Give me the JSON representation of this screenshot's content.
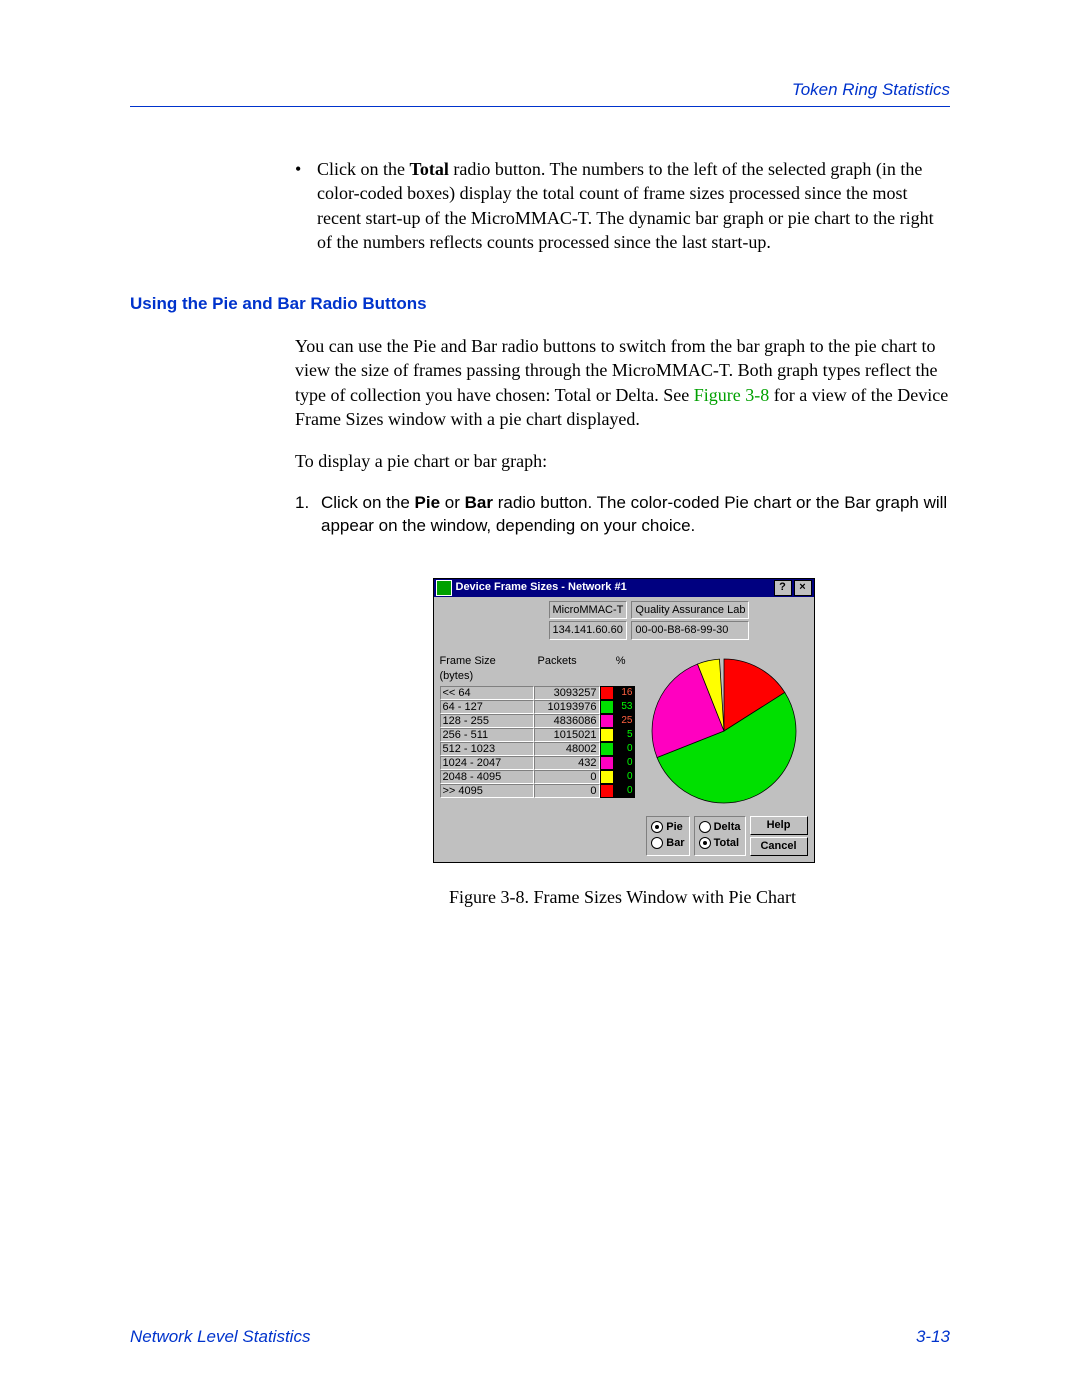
{
  "header": {
    "section": "Token Ring Statistics"
  },
  "bullet": {
    "pre": "Click on the ",
    "bold": "Total",
    "post": " radio button. The numbers to the left of the selected graph (in the color-coded boxes) display the total count of frame sizes processed since the most recent start-up of the MicroMMAC-T. The dynamic bar graph or pie chart to the right of the numbers reflects counts processed since the last start-up."
  },
  "subhead": "Using the Pie and Bar Radio Buttons",
  "para1": {
    "pre": "You can use the Pie and Bar radio buttons to switch from the bar graph to the pie chart to view the size of frames passing through the MicroMMAC-T. Both graph types reflect the type of collection you have chosen: Total or Delta. See ",
    "ref": "Figure 3-8",
    "post": " for a view of the Device Frame Sizes window with a pie chart displayed."
  },
  "para2": "To display a pie chart or bar graph:",
  "step1": {
    "num": "1.",
    "pre": "Click on the ",
    "b1": "Pie",
    "mid": " or ",
    "b2": "Bar",
    "post": " radio button. The color-coded Pie chart or the Bar graph will appear on the window, depending on your choice."
  },
  "caption": "Figure 3-8.  Frame Sizes Window with Pie Chart",
  "footer": {
    "left": "Network Level Statistics",
    "right": "3-13"
  },
  "dialog": {
    "title": "Device Frame Sizes - Network #1",
    "help_btn": "?",
    "close_btn": "×",
    "device": "MicroMMAC-T",
    "location": "Quality Assurance Lab",
    "ip": "134.141.60.60",
    "mac": "00-00-B8-68-99-30",
    "col1": "Frame Size (bytes)",
    "col2": "Packets",
    "col3": "%",
    "radios": {
      "pie": "Pie",
      "bar": "Bar",
      "delta": "Delta",
      "total": "Total"
    },
    "buttons": {
      "help": "Help",
      "cancel": "Cancel"
    }
  },
  "chart_data": {
    "type": "pie",
    "title": "Device Frame Sizes - Network #1",
    "categories": [
      "<< 64",
      "64 - 127",
      "128 - 255",
      "256 - 511",
      "512 - 1023",
      "1024 - 2047",
      "2048 - 4095",
      ">> 4095"
    ],
    "series": [
      {
        "name": "Packets",
        "values": [
          3093257,
          10193976,
          4836086,
          1015021,
          48002,
          432,
          0,
          0
        ]
      },
      {
        "name": "%",
        "values": [
          16,
          53,
          25,
          5,
          0,
          0,
          0,
          0
        ]
      }
    ],
    "colors": [
      "#ff0000",
      "#00e000",
      "#ff00c0",
      "#ffff00",
      "#00e000",
      "#ff00c0",
      "#ffff00",
      "#ff0000"
    ]
  }
}
